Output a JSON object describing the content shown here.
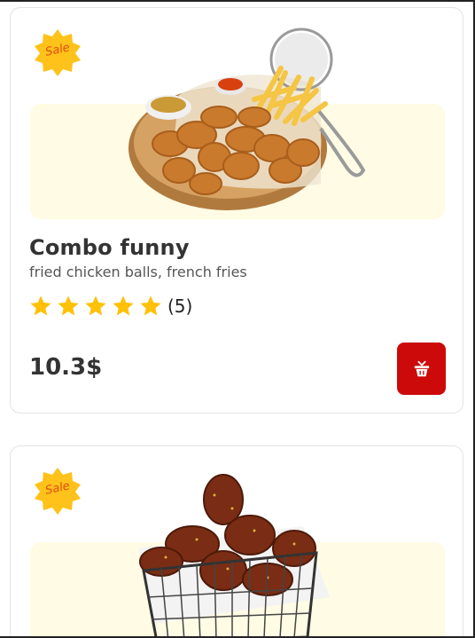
{
  "products": [
    {
      "badge": "Sale",
      "title": "Combo funny",
      "description": "fried chicken balls, french fries",
      "rating_stars": 5,
      "rating_count": "(5)",
      "price": "10.3$",
      "cart_icon": "basket-icon",
      "image": "fried-chicken-fries-platter"
    },
    {
      "badge": "Sale",
      "image": "glazed-chicken-wings-basket"
    }
  ],
  "colors": {
    "badge": "#ffc21a",
    "badge_text": "#e04b14",
    "image_bg": "#fffbe4",
    "star": "#ffc107",
    "cart_button": "#cc0a0a"
  }
}
